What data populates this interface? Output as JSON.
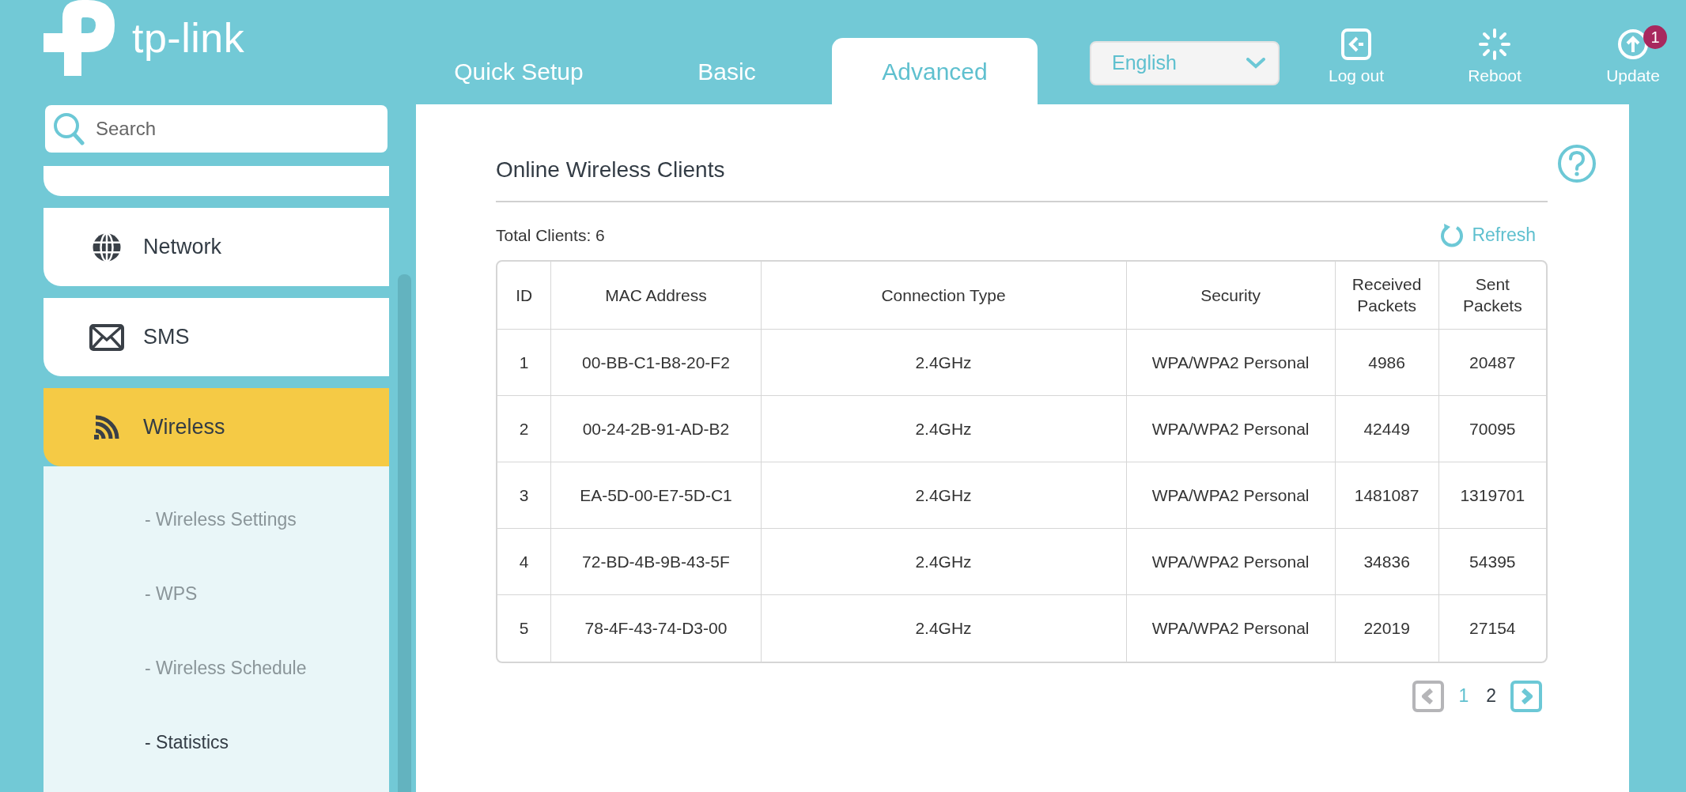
{
  "logo": {
    "text": "tp-link"
  },
  "tabs": [
    {
      "label": "Quick Setup",
      "selected": false
    },
    {
      "label": "Basic",
      "selected": false
    },
    {
      "label": "Advanced",
      "selected": true
    }
  ],
  "language": {
    "value": "English"
  },
  "actions": [
    {
      "kind": "logout",
      "label": "Log out"
    },
    {
      "kind": "reboot",
      "label": "Reboot"
    },
    {
      "kind": "update",
      "label": "Update",
      "badge": "1"
    }
  ],
  "search": {
    "placeholder": "Search"
  },
  "sidebar": {
    "items": [
      {
        "kind": "partial",
        "selected": false
      },
      {
        "kind": "network",
        "label": "Network",
        "selected": false
      },
      {
        "kind": "sms",
        "label": "SMS",
        "selected": false
      },
      {
        "kind": "wireless",
        "label": "Wireless",
        "selected": true,
        "expanded": true,
        "children": [
          {
            "label": "- Wireless Settings",
            "selected": false
          },
          {
            "label": "- WPS",
            "selected": false
          },
          {
            "label": "- Wireless Schedule",
            "selected": false
          },
          {
            "label": "- Statistics",
            "selected": true
          }
        ]
      }
    ]
  },
  "panel": {
    "title": "Online Wireless Clients",
    "total": "Total Clients: 6",
    "refresh": "Refresh",
    "table": {
      "columns": [
        "ID",
        "MAC Address",
        "Connection Type",
        "Security",
        "Received Packets",
        "Sent Packets"
      ],
      "rows": [
        [
          "1",
          "00-BB-C1-B8-20-F2",
          "2.4GHz",
          "WPA/WPA2 Personal",
          "4986",
          "20487"
        ],
        [
          "2",
          "00-24-2B-91-AD-B2",
          "2.4GHz",
          "WPA/WPA2 Personal",
          "42449",
          "70095"
        ],
        [
          "3",
          "EA-5D-00-E7-5D-C1",
          "2.4GHz",
          "WPA/WPA2 Personal",
          "1481087",
          "1319701"
        ],
        [
          "4",
          "72-BD-4B-9B-43-5F",
          "2.4GHz",
          "WPA/WPA2 Personal",
          "34836",
          "54395"
        ],
        [
          "5",
          "78-4F-43-74-D3-00",
          "2.4GHz",
          "WPA/WPA2 Personal",
          "22019",
          "27154"
        ]
      ]
    },
    "pagination": {
      "prev_disabled": true,
      "pages": [
        {
          "label": "1",
          "selected": true
        },
        {
          "label": "2",
          "selected": false
        }
      ],
      "next_disabled": false
    }
  }
}
